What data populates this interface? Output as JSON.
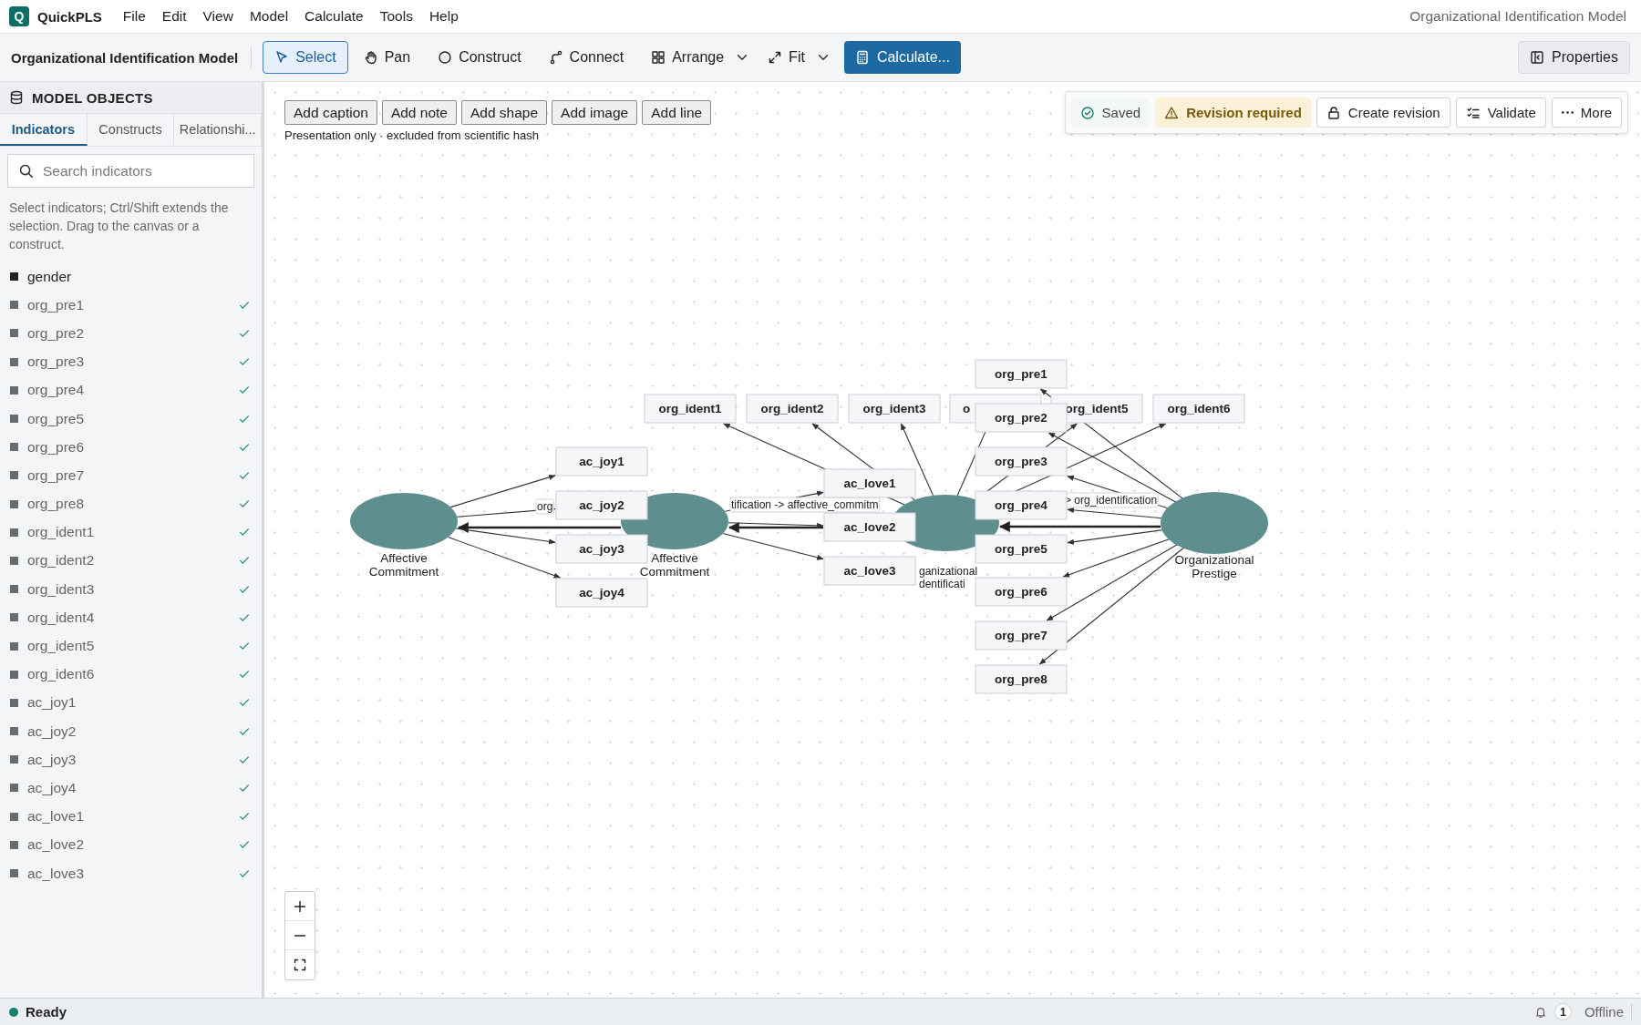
{
  "app": {
    "logo": "Q",
    "name": "QuickPLS"
  },
  "menu": [
    "File",
    "Edit",
    "View",
    "Model",
    "Calculate",
    "Tools",
    "Help"
  ],
  "window_title": "Organizational Identification Model",
  "toolbar": {
    "model_name": "Organizational Identification Model",
    "tools": [
      {
        "kind": "select",
        "label": "Select",
        "selected": true,
        "dropdown": false
      },
      {
        "kind": "pan",
        "label": "Pan",
        "selected": false,
        "dropdown": false
      },
      {
        "kind": "construct",
        "label": "Construct",
        "selected": false,
        "dropdown": false
      },
      {
        "kind": "connect",
        "label": "Connect",
        "selected": false,
        "dropdown": false
      },
      {
        "kind": "arrange",
        "label": "Arrange",
        "selected": false,
        "dropdown": true
      },
      {
        "kind": "fit",
        "label": "Fit",
        "selected": false,
        "dropdown": true
      }
    ],
    "calculate": "Calculate...",
    "properties": "Properties"
  },
  "sidebar": {
    "title": "MODEL OBJECTS",
    "tabs": [
      {
        "label": "Indicators",
        "selected": true
      },
      {
        "label": "Constructs",
        "selected": false
      },
      {
        "label": "Relationshi...",
        "selected": false
      }
    ],
    "search": {
      "placeholder": "Search indicators"
    },
    "hint": "Select indicators; Ctrl/Shift extends the selection. Drag to the canvas or a construct.",
    "items": [
      {
        "label": "gender",
        "used": false
      },
      {
        "label": "org_pre1",
        "used": true
      },
      {
        "label": "org_pre2",
        "used": true
      },
      {
        "label": "org_pre3",
        "used": true
      },
      {
        "label": "org_pre4",
        "used": true
      },
      {
        "label": "org_pre5",
        "used": true
      },
      {
        "label": "org_pre6",
        "used": true
      },
      {
        "label": "org_pre7",
        "used": true
      },
      {
        "label": "org_pre8",
        "used": true
      },
      {
        "label": "org_ident1",
        "used": true
      },
      {
        "label": "org_ident2",
        "used": true
      },
      {
        "label": "org_ident3",
        "used": true
      },
      {
        "label": "org_ident4",
        "used": true
      },
      {
        "label": "org_ident5",
        "used": true
      },
      {
        "label": "org_ident6",
        "used": true
      },
      {
        "label": "ac_joy1",
        "used": true
      },
      {
        "label": "ac_joy2",
        "used": true
      },
      {
        "label": "ac_joy3",
        "used": true
      },
      {
        "label": "ac_joy4",
        "used": true
      },
      {
        "label": "ac_love1",
        "used": true
      },
      {
        "label": "ac_love2",
        "used": true
      },
      {
        "label": "ac_love3",
        "used": true
      }
    ]
  },
  "canvas": {
    "annotation_buttons": [
      "Add caption",
      "Add note",
      "Add shape",
      "Add image",
      "Add line"
    ],
    "note": "Presentation only · excluded from scientific hash",
    "status_panel": [
      {
        "kind": "saved",
        "label": "Saved"
      },
      {
        "kind": "warning",
        "label": "Revision required"
      },
      {
        "kind": "lock",
        "label": "Create revision"
      },
      {
        "kind": "validate",
        "label": "Validate"
      },
      {
        "kind": "more",
        "label": "More"
      }
    ],
    "diagram": {
      "path_labels": [
        "org",
        "tification -> affective_commitm",
        "> org_identification"
      ],
      "constructs": [
        {
          "label": [
            "Affective",
            "Commitment"
          ],
          "indicators": [
            "ac_joy1",
            "ac_joy2",
            "ac_joy3",
            "ac_joy4"
          ]
        },
        {
          "label": [
            "Affective",
            "Commitment"
          ],
          "indicators": [
            "ac_love1",
            "ac_love2",
            "ac_love3"
          ]
        },
        {
          "label": [
            "ganizational",
            "dentificati"
          ],
          "indicators": [
            "org_ident1",
            "org_ident2",
            "org_ident3",
            "o",
            "org_ident5",
            "org_ident6"
          ]
        },
        {
          "label": [
            "Organizational",
            "Prestige"
          ],
          "indicators": [
            "org_pre1",
            "org_pre2",
            "org_pre3",
            "org_pre4",
            "org_pre5",
            "org_pre6",
            "org_pre7",
            "org_pre8"
          ]
        }
      ]
    }
  },
  "status_bar": {
    "state": "Ready",
    "notifications": "1",
    "connection": "Offline"
  }
}
